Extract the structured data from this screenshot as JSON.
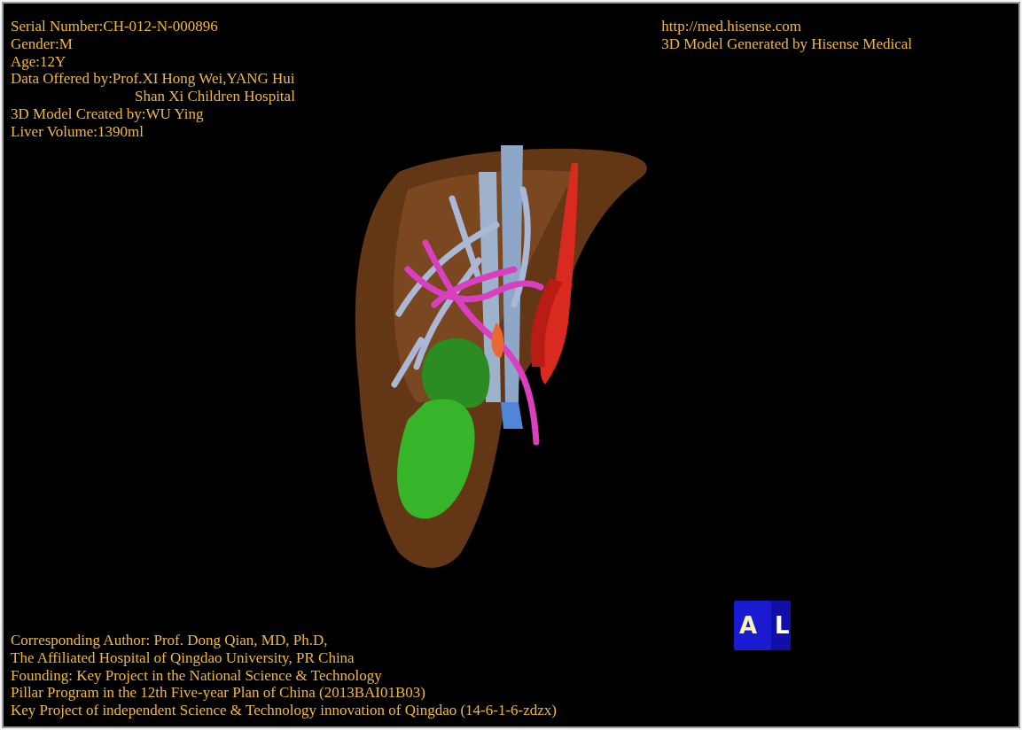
{
  "patient_info": [
    {
      "text": "Serial Number:CH-012-N-000896",
      "indent": false
    },
    {
      "text": "Gender:M",
      "indent": false
    },
    {
      "text": "Age:12Y",
      "indent": false
    },
    {
      "text": "Data Offered by:Prof.XI Hong Wei,YANG Hui",
      "indent": false
    },
    {
      "text": "Shan Xi Children Hospital",
      "indent": true
    },
    {
      "text": "3D Model Created by:WU Ying",
      "indent": false
    },
    {
      "text": "Liver Volume:1390ml",
      "indent": false
    }
  ],
  "vendor_info": [
    "http://med.hisense.com",
    "3D Model Generated by Hisense Medical"
  ],
  "credits": [
    "Corresponding Author: Prof. Dong Qian, MD, Ph.D,",
    "The Affiliated Hospital of Qingdao University, PR China",
    "Founding: Key Project in the National Science & Technology",
    "Pillar Program in the 12th Five-year Plan of China (2013BAI01B03)",
    "Key Project of independent Science & Technology innovation of Qingdao (14-6-1-6-zdzx)"
  ],
  "orientation_cube": {
    "faces": [
      "A",
      "L"
    ]
  }
}
